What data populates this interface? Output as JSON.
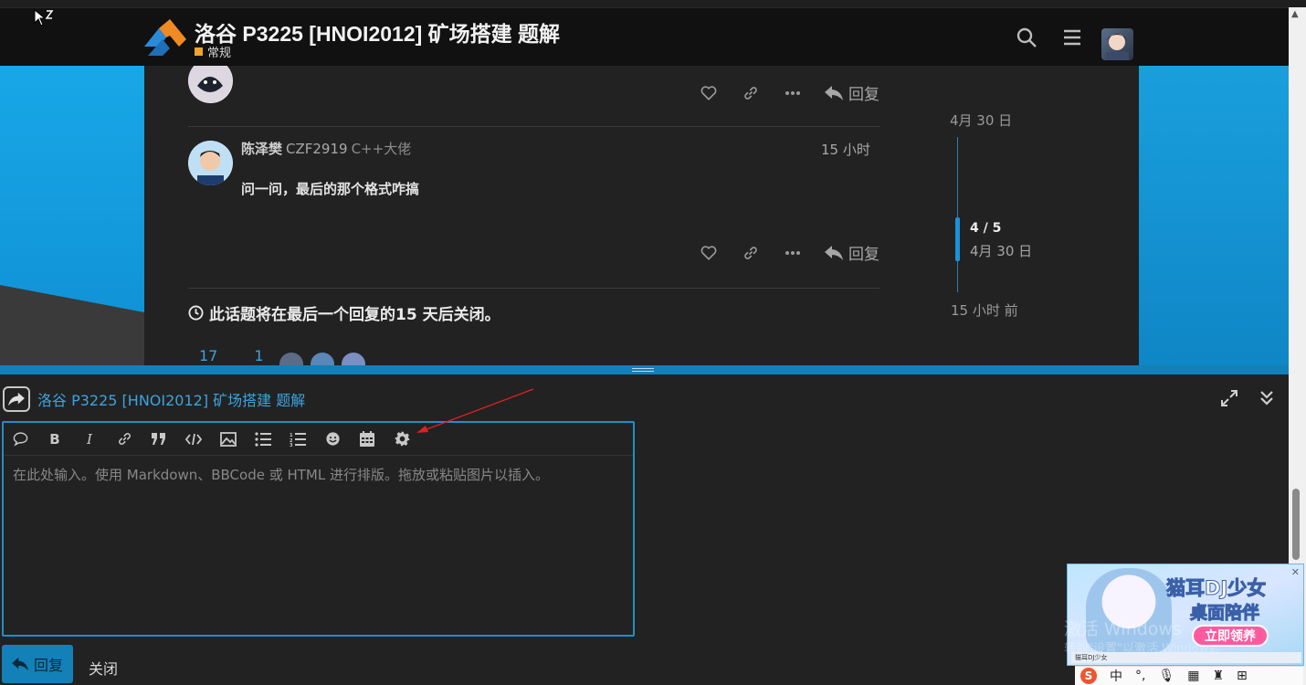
{
  "header": {
    "title": "洛谷 P3225 [HNOI2012] 矿场搭建 题解",
    "category": "常规",
    "category_color": "#f1a42a"
  },
  "post_top": {
    "reply_label": "回复"
  },
  "post": {
    "username": "陈泽樊",
    "name": "CZF2919",
    "user_title": "C++大佬",
    "time": "15 小时",
    "body": "问一问，最后的那个格式咋搞",
    "reply_label": "回复"
  },
  "closing_notice": "此话题将在最后一个回复的15 天后关闭。",
  "stats": {
    "views": "17",
    "users": "1"
  },
  "timeline": {
    "start_date": "4月 30 日",
    "position": "4 / 5",
    "current_date": "4月 30 日",
    "end_label": "15 小时 前"
  },
  "composer": {
    "topic_link": "洛谷 P3225 [HNOI2012] 矿场搭建 题解",
    "placeholder": "在此处输入。使用 Markdown、BBCode 或 HTML 进行排版。拖放或粘贴图片以插入。",
    "reply_button": "回复",
    "close_button": "关闭"
  },
  "overlay": {
    "ad_title": "猫耳DJ少女",
    "ad_subtitle": "桌面陪伴",
    "ad_button": "立即领养",
    "ad_taskbar": "猫耳DJ少女",
    "watermark_line1": "激活 Windows",
    "watermark_line2": "转到\"设置\"以激活 Windows。",
    "ime_label": "中"
  },
  "colors": {
    "accent": "#1380b8",
    "link": "#3aa4e0",
    "background": "#222222",
    "header": "#111111"
  }
}
